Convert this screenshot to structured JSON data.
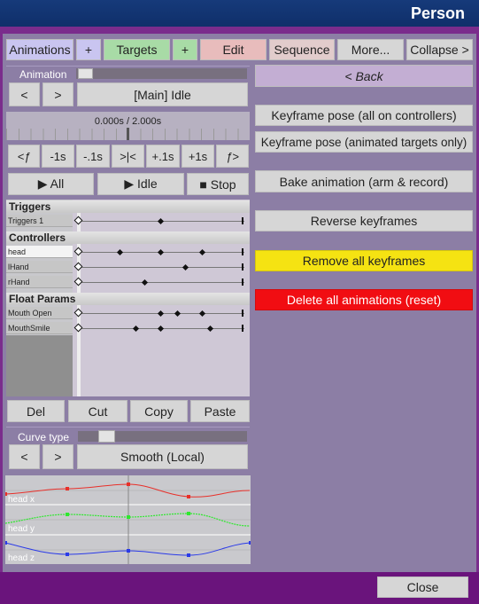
{
  "window": {
    "title": "Person"
  },
  "tabs": {
    "animations": "Animations",
    "add1": "+",
    "targets": "Targets",
    "add2": "+",
    "edit": "Edit",
    "sequence": "Sequence",
    "more": "More...",
    "collapse": "Collapse >"
  },
  "animation": {
    "label": "Animation",
    "prev": "<",
    "next": ">",
    "current": "[Main] Idle"
  },
  "time": {
    "display": "0.000s / 2.000s"
  },
  "nav": {
    "prev_kf": "<ƒ",
    "m1": "-1s",
    "m01": "-.1s",
    "snap": ">|<",
    "p01": "+.1s",
    "p1": "+1s",
    "next_kf": "ƒ>"
  },
  "playback": {
    "all": "▶ All",
    "idle": "▶ Idle",
    "stop": "■ Stop"
  },
  "dopesheet": {
    "triggers_header": "Triggers",
    "controllers_header": "Controllers",
    "float_header": "Float Params",
    "rows": {
      "trig1": "Triggers 1",
      "head": "head",
      "lhand": "lHand",
      "rhand": "rHand",
      "mouth_open": "Mouth Open",
      "mouth_smile": "MouthSmile"
    }
  },
  "edit": {
    "del": "Del",
    "cut": "Cut",
    "copy": "Copy",
    "paste": "Paste"
  },
  "curve": {
    "label": "Curve type",
    "prev": "<",
    "next": ">",
    "current": "Smooth (Local)",
    "graphs": {
      "x": "head x",
      "y": "head y",
      "z": "head z"
    },
    "colors": {
      "x": "#e8302a",
      "y": "#2ee82e",
      "z": "#2a3ae8"
    }
  },
  "actions": {
    "back": "< Back",
    "kf_controllers": "Keyframe pose (all on controllers)",
    "kf_targets": "Keyframe pose (animated targets only)",
    "bake": "Bake animation (arm & record)",
    "reverse": "Reverse keyframes",
    "remove_all": "Remove all keyframes",
    "delete_all": "Delete all animations (reset)"
  },
  "footer": {
    "close": "Close"
  }
}
